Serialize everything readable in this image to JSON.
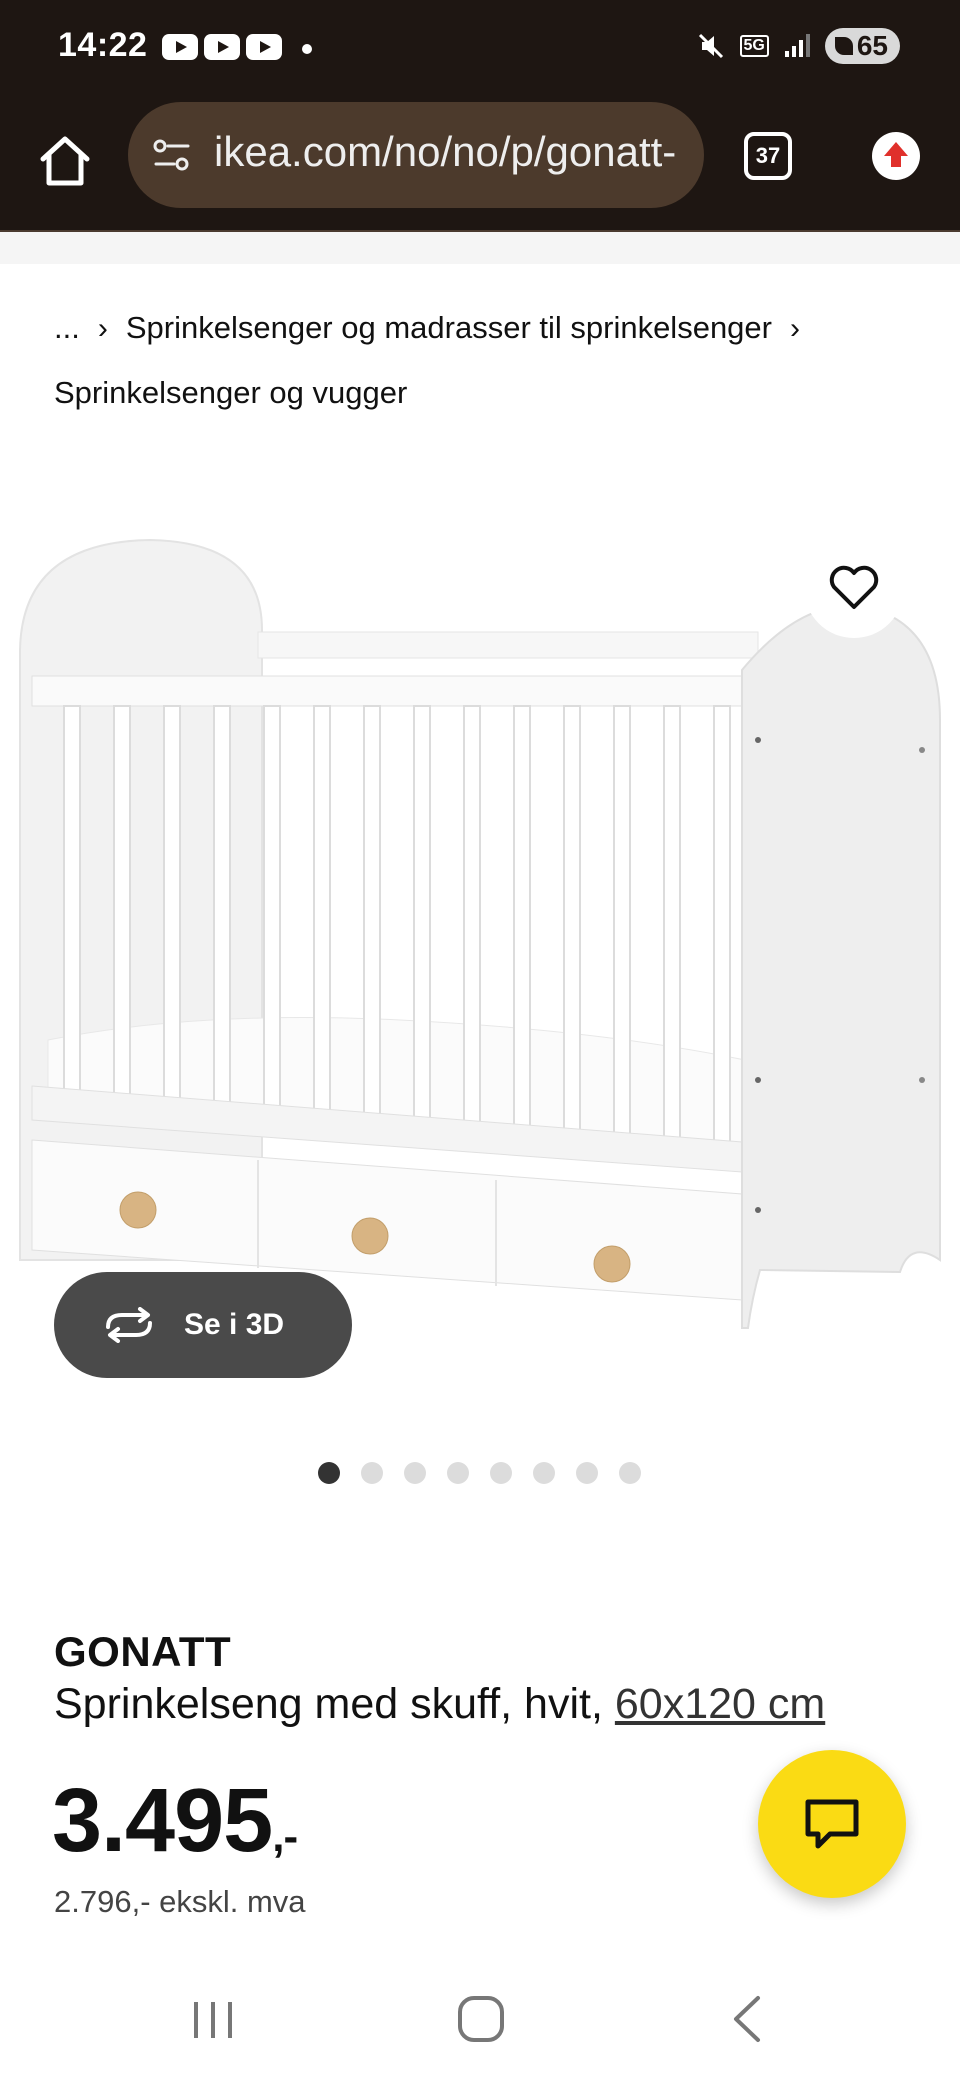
{
  "status_bar": {
    "time": "14:22",
    "notification_icons": [
      "youtube-icon",
      "youtube-icon",
      "youtube-icon"
    ],
    "network": "5G",
    "battery": "65"
  },
  "browser": {
    "url": "ikea.com/no/no/p/gonatt-",
    "tab_count": "37"
  },
  "breadcrumb": {
    "ellipsis": "...",
    "items": [
      "Sprinkelsenger og madrasser til sprinkelsenger",
      "Sprinkelsenger og vugger"
    ]
  },
  "gallery": {
    "view_3d_label": "Se i 3D",
    "image_count": 8,
    "active_index": 0
  },
  "product": {
    "name": "GONATT",
    "description": "Sprinkelseng med skuff, hvit,",
    "size": "60x120 cm",
    "price_main": "3.495",
    "price_suffix": ",-",
    "price_ex_vat": "2.796,- ekskl. mva"
  },
  "colors": {
    "browser_chrome": "#1e1612",
    "url_pill": "#4c3a2c",
    "chat_fab": "#fadb14",
    "view_3d_button": "#4a4a4a"
  }
}
